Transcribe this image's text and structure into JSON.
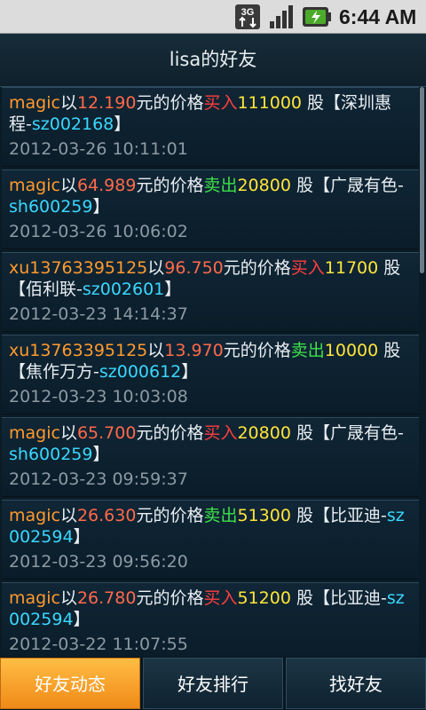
{
  "status_bar": {
    "network_label": "3G",
    "time": "6:44 AM",
    "icons": [
      "3g-data-icon",
      "signal-strength-icon",
      "battery-charging-icon"
    ]
  },
  "header": {
    "title": "lisa的好友"
  },
  "feed": {
    "items": [
      {
        "user": "magic",
        "t1": "以",
        "price": "12.190",
        "t2": "元的价格",
        "action": "买入",
        "action_type": "buy",
        "qty": "111000",
        "t3": " 股【深圳惠程-",
        "code": "sz002168",
        "t4": "】",
        "time": "2012-03-26 10:11:01"
      },
      {
        "user": "magic",
        "t1": "以",
        "price": "64.989",
        "t2": "元的价格",
        "action": "卖出",
        "action_type": "sell",
        "qty": "20800",
        "t3": " 股【广晟有色-",
        "code": "sh600259",
        "t4": "】",
        "time": "2012-03-26 10:06:02"
      },
      {
        "user": "xu13763395125",
        "t1": "以",
        "price": "96.750",
        "t2": "元的价格",
        "action": "买入",
        "action_type": "buy",
        "qty": "11700",
        "t3": " 股【佰利联-",
        "code": "sz002601",
        "t4": "】",
        "time": "2012-03-23 14:14:37"
      },
      {
        "user": "xu13763395125",
        "t1": "以",
        "price": "13.970",
        "t2": "元的价格",
        "action": "卖出",
        "action_type": "sell",
        "qty": "10000",
        "t3": " 股【焦作万方-",
        "code": "sz000612",
        "t4": "】",
        "time": "2012-03-23 10:03:08"
      },
      {
        "user": "magic",
        "t1": "以",
        "price": "65.700",
        "t2": "元的价格",
        "action": "买入",
        "action_type": "buy",
        "qty": "20800",
        "t3": " 股【广晟有色-",
        "code": "sh600259",
        "t4": "】",
        "time": "2012-03-23 09:59:37"
      },
      {
        "user": "magic",
        "t1": "以",
        "price": "26.630",
        "t2": "元的价格",
        "action": "卖出",
        "action_type": "sell",
        "qty": "51300",
        "t3": " 股【比亚迪-",
        "code": "sz002594",
        "t4": "】",
        "time": "2012-03-23 09:56:20"
      },
      {
        "user": "magic",
        "t1": "以",
        "price": "26.780",
        "t2": "元的价格",
        "action": "买入",
        "action_type": "buy",
        "qty": "51200",
        "t3": " 股【比亚迪-",
        "code": "sz002594",
        "t4": "】",
        "time": "2012-03-22 11:07:55"
      }
    ]
  },
  "tabs": [
    {
      "label": "好友动态",
      "selected": true
    },
    {
      "label": "好友排行",
      "selected": false
    },
    {
      "label": "找好友",
      "selected": false
    }
  ],
  "colors": {
    "user": "#ff9a2e",
    "price": "#ff6a4a",
    "buy": "#ff3e3e",
    "sell": "#3ee04a",
    "quantity": "#ffe53a",
    "stock_code": "#39d8ff",
    "timestamp": "#8c9aa3",
    "active_tab": "#f5a12a"
  }
}
